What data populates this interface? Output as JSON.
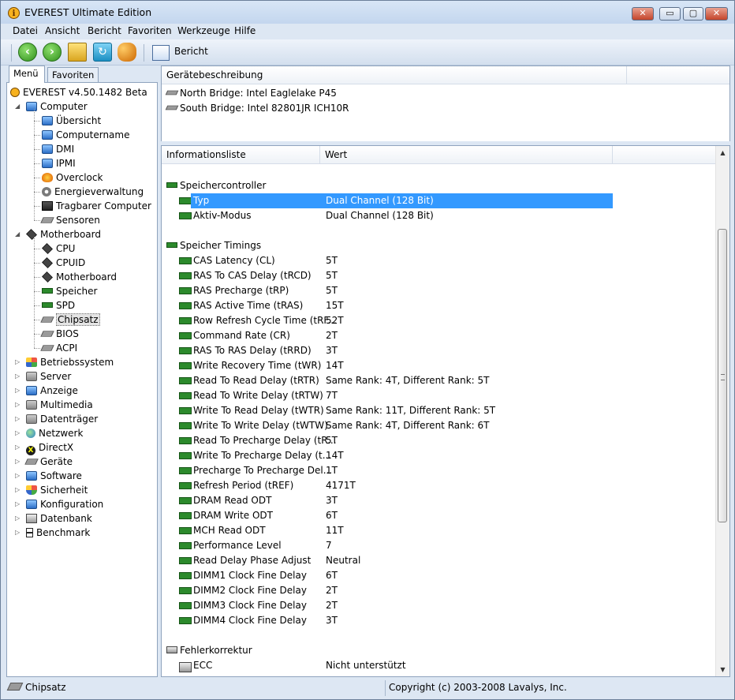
{
  "window": {
    "title": "EVEREST Ultimate Edition",
    "minimize": "▭",
    "maximize": "▢",
    "close": "✕"
  },
  "menu": [
    "Datei",
    "Ansicht",
    "Bericht",
    "Favoriten",
    "Werkzeuge",
    "Hilfe"
  ],
  "toolbar": {
    "report_label": "Bericht"
  },
  "left": {
    "tabs": [
      "Menü",
      "Favoriten"
    ],
    "tree": [
      {
        "label": "EVEREST v4.50.1482 Beta",
        "icon": "info-icon",
        "level": 0
      },
      {
        "label": "Computer",
        "icon": "computer-icon",
        "level": 1,
        "expanded": true
      },
      {
        "label": "Übersicht",
        "icon": "monitor-icon",
        "level": 2
      },
      {
        "label": "Computername",
        "icon": "monitor-icon",
        "level": 2
      },
      {
        "label": "DMI",
        "icon": "monitor-icon",
        "level": 2
      },
      {
        "label": "IPMI",
        "icon": "monitor-icon",
        "level": 2
      },
      {
        "label": "Overclock",
        "icon": "fire-icon",
        "level": 2
      },
      {
        "label": "Energieverwaltung",
        "icon": "power-icon",
        "level": 2
      },
      {
        "label": "Tragbarer Computer",
        "icon": "laptop-icon",
        "level": 2
      },
      {
        "label": "Sensoren",
        "icon": "sensor-icon",
        "level": 2
      },
      {
        "label": "Motherboard",
        "icon": "motherboard-icon",
        "level": 1,
        "expanded": true
      },
      {
        "label": "CPU",
        "icon": "cpu-icon",
        "level": 2
      },
      {
        "label": "CPUID",
        "icon": "cpu-icon",
        "level": 2
      },
      {
        "label": "Motherboard",
        "icon": "motherboard-icon",
        "level": 2
      },
      {
        "label": "Speicher",
        "icon": "memory-icon",
        "level": 2
      },
      {
        "label": "SPD",
        "icon": "memory-icon",
        "level": 2
      },
      {
        "label": "Chipsatz",
        "icon": "chipset-icon",
        "level": 2,
        "selected": true
      },
      {
        "label": "BIOS",
        "icon": "chipset-icon",
        "level": 2
      },
      {
        "label": "ACPI",
        "icon": "chipset-icon",
        "level": 2
      },
      {
        "label": "Betriebssystem",
        "icon": "windows-icon",
        "level": 1
      },
      {
        "label": "Server",
        "icon": "server-icon",
        "level": 1
      },
      {
        "label": "Anzeige",
        "icon": "display-icon",
        "level": 1
      },
      {
        "label": "Multimedia",
        "icon": "multimedia-icon",
        "level": 1
      },
      {
        "label": "Datenträger",
        "icon": "storage-icon",
        "level": 1
      },
      {
        "label": "Netzwerk",
        "icon": "network-icon",
        "level": 1
      },
      {
        "label": "DirectX",
        "icon": "directx-icon",
        "level": 1
      },
      {
        "label": "Geräte",
        "icon": "devices-icon",
        "level": 1
      },
      {
        "label": "Software",
        "icon": "software-icon",
        "level": 1
      },
      {
        "label": "Sicherheit",
        "icon": "security-icon",
        "level": 1
      },
      {
        "label": "Konfiguration",
        "icon": "config-icon",
        "level": 1
      },
      {
        "label": "Datenbank",
        "icon": "database-icon",
        "level": 1
      },
      {
        "label": "Benchmark",
        "icon": "hourglass-icon",
        "level": 1
      }
    ]
  },
  "devices": {
    "header": "Gerätebeschreibung",
    "items": [
      "North Bridge: Intel Eaglelake P45",
      "South Bridge: Intel 82801JR ICH10R"
    ]
  },
  "info": {
    "col_name": "Informationsliste",
    "col_value": "Wert",
    "rows": [
      {
        "type": "group",
        "label": "Speichercontroller",
        "icon": "memory-icon"
      },
      {
        "type": "item",
        "label": "Typ",
        "value": "Dual Channel  (128 Bit)",
        "selected": true
      },
      {
        "type": "item",
        "label": "Aktiv-Modus",
        "value": "Dual Channel  (128 Bit)"
      },
      {
        "type": "blank"
      },
      {
        "type": "group",
        "label": "Speicher Timings",
        "icon": "memory-icon"
      },
      {
        "type": "item",
        "label": "CAS Latency (CL)",
        "value": "5T"
      },
      {
        "type": "item",
        "label": "RAS To CAS Delay (tRCD)",
        "value": "5T"
      },
      {
        "type": "item",
        "label": "RAS Precharge (tRP)",
        "value": "5T"
      },
      {
        "type": "item",
        "label": "RAS Active Time (tRAS)",
        "value": "15T"
      },
      {
        "type": "item",
        "label": "Row Refresh Cycle Time (tRF...",
        "value": "52T"
      },
      {
        "type": "item",
        "label": "Command Rate (CR)",
        "value": "2T"
      },
      {
        "type": "item",
        "label": "RAS To RAS Delay (tRRD)",
        "value": "3T"
      },
      {
        "type": "item",
        "label": "Write Recovery Time (tWR)",
        "value": "14T"
      },
      {
        "type": "item",
        "label": "Read To Read Delay (tRTR)",
        "value": "Same Rank: 4T, Different Rank: 5T"
      },
      {
        "type": "item",
        "label": "Read To Write Delay (tRTW)",
        "value": "7T"
      },
      {
        "type": "item",
        "label": "Write To Read Delay (tWTR)",
        "value": "Same Rank: 11T, Different Rank: 5T"
      },
      {
        "type": "item",
        "label": "Write To Write Delay (tWTW)",
        "value": "Same Rank: 4T, Different Rank: 6T"
      },
      {
        "type": "item",
        "label": "Read To Precharge Delay (tR...",
        "value": "5T"
      },
      {
        "type": "item",
        "label": "Write To Precharge Delay (t...",
        "value": "14T"
      },
      {
        "type": "item",
        "label": "Precharge To Precharge Del...",
        "value": "1T"
      },
      {
        "type": "item",
        "label": "Refresh Period (tREF)",
        "value": "4171T"
      },
      {
        "type": "item",
        "label": "DRAM Read ODT",
        "value": "3T"
      },
      {
        "type": "item",
        "label": "DRAM Write ODT",
        "value": "6T"
      },
      {
        "type": "item",
        "label": "MCH Read ODT",
        "value": "11T"
      },
      {
        "type": "item",
        "label": "Performance Level",
        "value": "7"
      },
      {
        "type": "item",
        "label": "Read Delay Phase Adjust",
        "value": "Neutral"
      },
      {
        "type": "item",
        "label": "DIMM1 Clock Fine Delay",
        "value": "6T"
      },
      {
        "type": "item",
        "label": "DIMM2 Clock Fine Delay",
        "value": "2T"
      },
      {
        "type": "item",
        "label": "DIMM3 Clock Fine Delay",
        "value": "2T"
      },
      {
        "type": "item",
        "label": "DIMM4 Clock Fine Delay",
        "value": "3T"
      },
      {
        "type": "blank"
      },
      {
        "type": "group",
        "label": "Fehlerkorrektur",
        "icon": "error-correction-icon"
      },
      {
        "type": "item",
        "label": "ECC",
        "value": "Nicht unterstützt"
      }
    ]
  },
  "status": {
    "left": "Chipsatz",
    "right": "Copyright (c) 2003-2008 Lavalys, Inc."
  },
  "colors": {
    "selection": "#3399ff",
    "window_frame": "#dde7f3"
  }
}
